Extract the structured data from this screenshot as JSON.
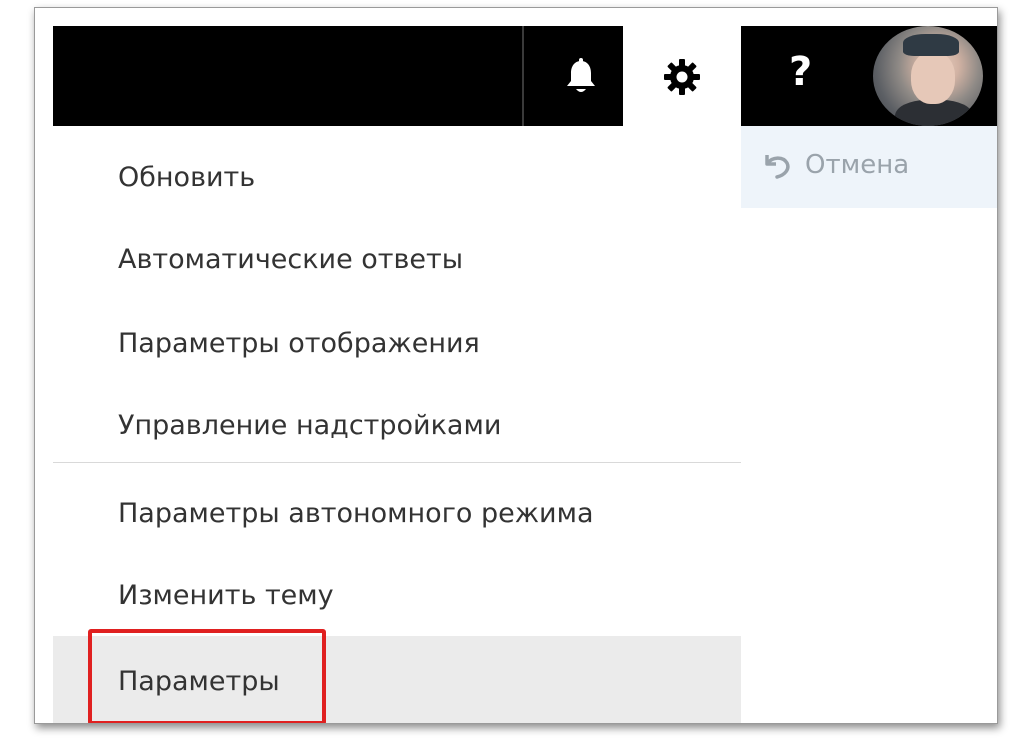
{
  "header": {
    "notifications_icon": "bell-icon",
    "settings_icon": "gear-icon",
    "help_label": "?",
    "avatar_icon": "user-avatar"
  },
  "commandbar": {
    "undo_label": "Отмена",
    "undo_icon": "undo-icon"
  },
  "settings_menu": {
    "items": [
      {
        "label": "Обновить"
      },
      {
        "label": "Автоматические ответы"
      },
      {
        "label": "Параметры отображения"
      },
      {
        "label": "Управление надстройками"
      },
      {
        "label": "Параметры автономного режима"
      },
      {
        "label": "Изменить тему"
      },
      {
        "label": "Параметры"
      }
    ],
    "selected_item": "Параметры"
  },
  "colors": {
    "topbar": "#000000",
    "highlight": "#e02020",
    "commandbar": "#eef4fa"
  }
}
